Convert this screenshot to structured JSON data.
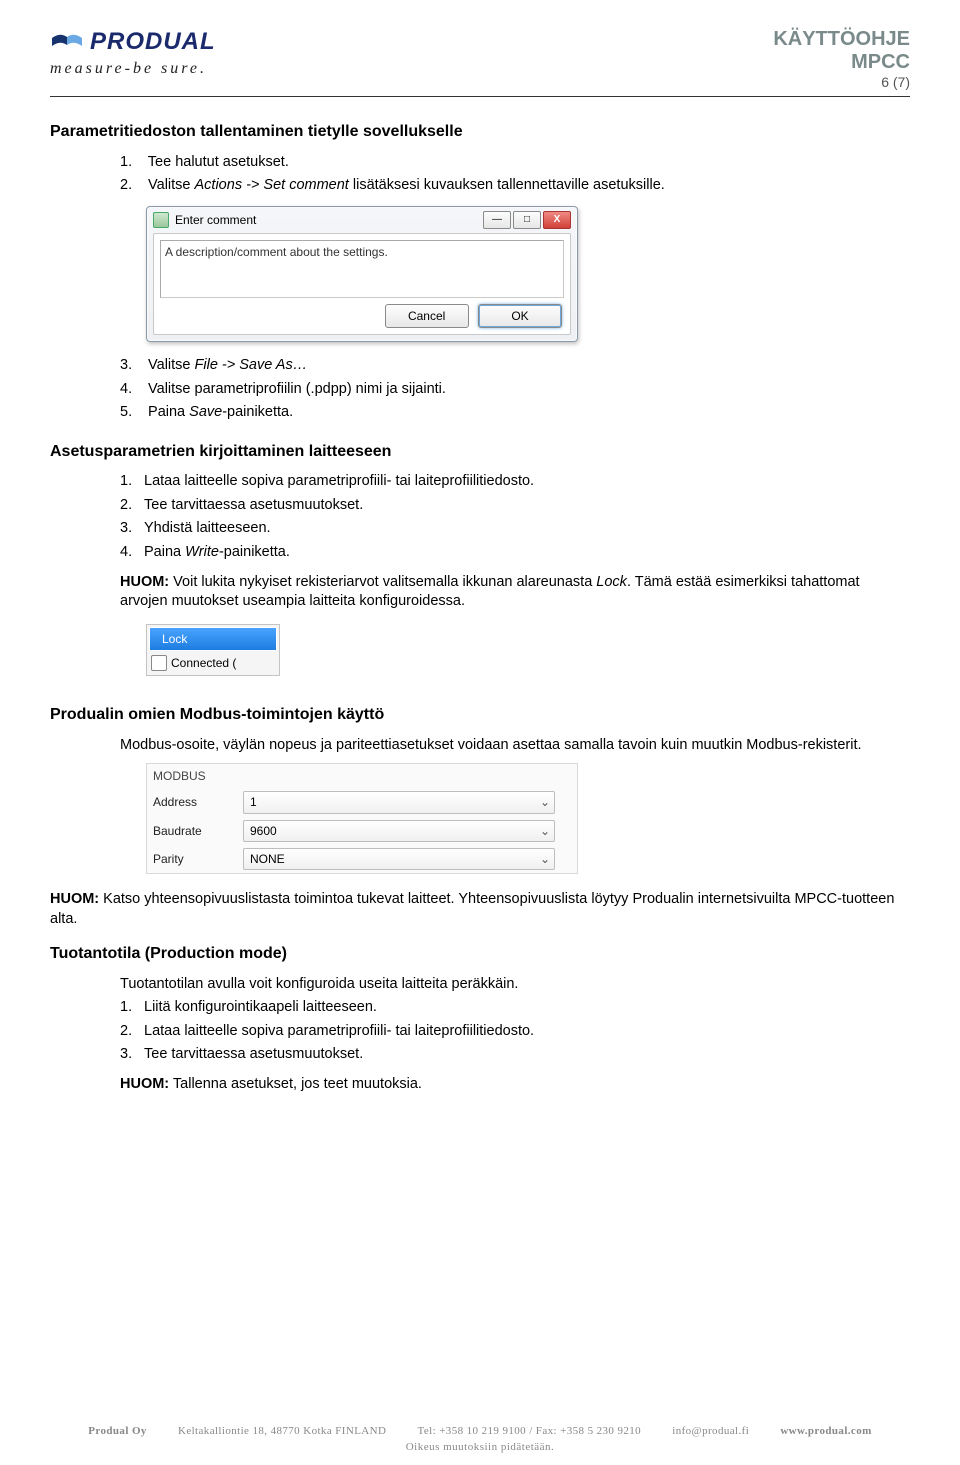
{
  "header": {
    "brand_word": "PRODUAL",
    "tagline": "measure-be sure.",
    "doc_type": "KÄYTTÖOHJE",
    "product": "MPCC",
    "page_num": "6 (7)"
  },
  "sec1": {
    "title": "Parametritiedoston tallentaminen tietylle sovellukselle",
    "items": {
      "n1": "1.",
      "t1": "Tee halutut asetukset.",
      "n2": "2.",
      "t2a": "Valitse ",
      "t2b": "Actions -> Set comment",
      "t2c": " lisätäksesi kuvauksen tallennettaville asetuksille.",
      "n3": "3.",
      "t3a": "Valitse ",
      "t3b": "File -> Save As…",
      "n4": "4.",
      "t4": "Valitse parametriprofiilin (.pdpp) nimi ja sijainti.",
      "n5": "5.",
      "t5a": "Paina ",
      "t5b": "Save",
      "t5c": "-painiketta."
    }
  },
  "dialog1": {
    "title": "Enter comment",
    "text": "A description/comment about the settings.",
    "ok": "OK",
    "cancel": "Cancel",
    "min": "—",
    "max": "□",
    "close": "X"
  },
  "sec2": {
    "title": "Asetusparametrien kirjoittaminen laitteeseen",
    "items": {
      "n1": "1.",
      "t1": "Lataa laitteelle sopiva parametriprofiili- tai laiteprofiilitiedosto.",
      "n2": "2.",
      "t2": "Tee tarvittaessa asetusmuutokset.",
      "n3": "3.",
      "t3": "Yhdistä laitteeseen.",
      "n4": "4.",
      "t4a": "Paina ",
      "t4b": "Write",
      "t4c": "-painiketta."
    },
    "note_lbl": "HUOM:",
    "note_a": " Voit lukita nykyiset rekisteriarvot valitsemalla ikkunan alareunasta ",
    "note_b": "Lock",
    "note_c": ". Tämä estää esimerkiksi tahattomat arvojen muutokset useampia laitteita konfiguroidessa."
  },
  "lock_snip": {
    "lock": "Lock",
    "connected": "Connected ("
  },
  "sec3": {
    "title": "Produalin omien Modbus-toimintojen käyttö",
    "para": "Modbus-osoite, väylän nopeus ja pariteettiasetukset voidaan asettaa samalla tavoin kuin muutkin Modbus-rekisterit."
  },
  "modbus": {
    "hdr": "MODBUS",
    "rows": [
      {
        "label": "Address",
        "value": "1"
      },
      {
        "label": "Baudrate",
        "value": "9600"
      },
      {
        "label": "Parity",
        "value": "NONE"
      }
    ]
  },
  "sec3_note": {
    "lbl": "HUOM:",
    "txt": " Katso yhteensopivuuslistasta toimintoa tukevat laitteet. Yhteensopivuuslista löytyy Produalin internetsivuilta MPCC-tuotteen alta."
  },
  "sec4": {
    "title": "Tuotantotila (Production mode)",
    "para": "Tuotantotilan avulla voit konfiguroida useita laitteita peräkkäin.",
    "items": {
      "n1": "1.",
      "t1": "Liitä konfigurointikaapeli laitteeseen.",
      "n2": "2.",
      "t2": "Lataa laitteelle sopiva parametriprofiili- tai laiteprofiilitiedosto.",
      "n3": "3.",
      "t3": "Tee tarvittaessa asetusmuutokset."
    },
    "note_lbl": "HUOM:",
    "note_txt": " Tallenna asetukset, jos teet muutoksia."
  },
  "footer": {
    "company": "Produal Oy",
    "addr": "Keltakalliontie 18, 48770 Kotka FINLAND",
    "telfax": "Tel: +358 10 219 9100 / Fax: +358 5 230 9210",
    "email": "info@produal.fi",
    "web": "www.produal.com",
    "disclaimer": "Oikeus muutoksiin pidätetään."
  }
}
